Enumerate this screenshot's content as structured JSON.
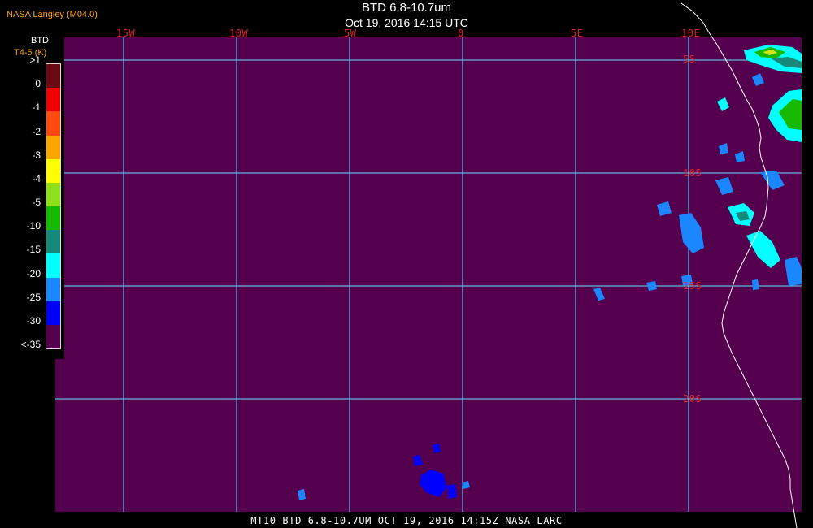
{
  "header": {
    "agency": "NASA Langley (M04.0)",
    "title": "BTD 6.8-10.7um",
    "datetime": "Oct 19, 2016 14:15 UTC"
  },
  "legend": {
    "title": "BTD",
    "subtitle": "T4-5 (K)",
    "labels": [
      ">1",
      "0",
      "-1",
      "-2",
      "-3",
      "-4",
      "-5",
      "-10",
      "-15",
      "-20",
      "-25",
      "-30",
      "<-35"
    ],
    "colors": [
      "#6b0a12",
      "#f00000",
      "#ff4a10",
      "#ffa500",
      "#ffff00",
      "#8fe01c",
      "#16b800",
      "#15897a",
      "#00ffff",
      "#1a86ff",
      "#0000ff",
      "#55004f"
    ]
  },
  "map": {
    "background_color": "#55004f",
    "grid_color": "#66ddff",
    "coast_color": "#ffffff",
    "label_color": "#e0202a",
    "longitude_labels": [
      "15W",
      "10W",
      "5W",
      "0",
      "5E",
      "10E"
    ],
    "latitude_labels": [
      "5S",
      "10S",
      "15S",
      "20S"
    ]
  },
  "footer": {
    "caption": "MT10  BTD 6.8-10.7UM   OCT 19, 2016 14:15Z   NASA LARC"
  }
}
